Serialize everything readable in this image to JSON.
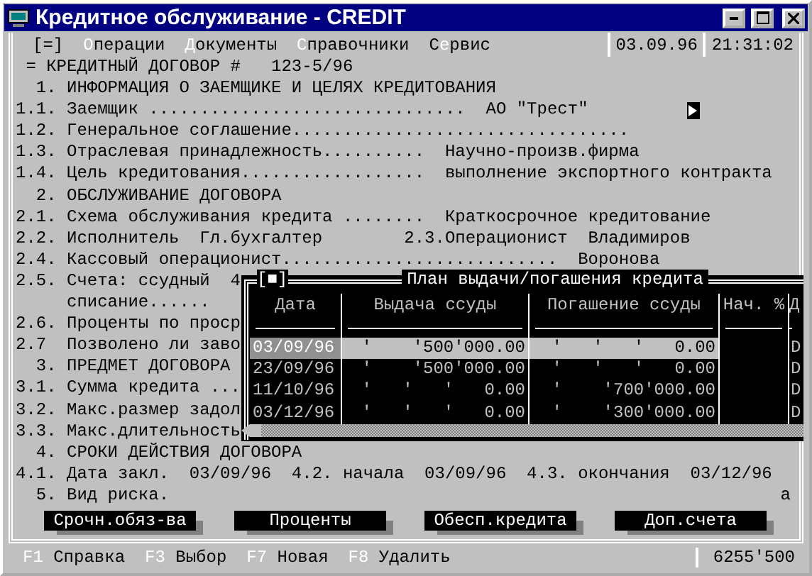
{
  "window": {
    "title": "Кредитное обслуживание - CREDIT"
  },
  "menu": {
    "system": "[=]",
    "items": [
      {
        "hotkey": "О",
        "rest": "перации"
      },
      {
        "hotkey": "Д",
        "rest": "окументы"
      },
      {
        "hotkey": "С",
        "rest": "правочники"
      },
      {
        "hotkey": "е",
        "lead": "С",
        "rest": "рвис"
      }
    ],
    "date": "03.09.96",
    "time": "21:31:02"
  },
  "form": {
    "lines": [
      {
        "text": " = КРЕДИТНЫЙ ДОГОВОР #   123-5/96"
      },
      {
        "text": "  1. ИНФОРМАЦИЯ О ЗАЕМЩИКЕ И ЦЕЛЯХ КРЕДИТОВАНИЯ"
      },
      {
        "text": "1.1. Заемщик ...............................  АО \"Трест\"",
        "marker": true
      },
      {
        "text": "1.2. Генеральное соглашение................................."
      },
      {
        "text": "1.3. Отраслевая принадлежность..........  Научно-произв.фирма"
      },
      {
        "text": "1.4. Цель кредитования..................  выполнение экспортного контракта"
      },
      {
        "text": "  2. ОБСЛУЖИВАНИЕ ДОГОВОРА"
      },
      {
        "text": "2.1. Схема обслуживания кредита ........  Краткосрочное кредитование"
      },
      {
        "text": "2.2. Исполнитель  Гл.бухгалтер        2.3.Операционист  Владимиров"
      },
      {
        "text": "2.4. Кассовый операционист...........................  Воронова"
      },
      {
        "text": "2.5. Счета: ссудный  4"
      },
      {
        "text": "     списание......"
      },
      {
        "text": "2.6. Проценты по проср"
      },
      {
        "text": "2.7  Позволено ли заво"
      },
      {
        "text": "  3. ПРЕДМЕТ ДОГОВОРА"
      },
      {
        "text": "3.1. Сумма кредита ..."
      },
      {
        "text": "3.2. Макс.размер задол"
      },
      {
        "text": "3.3. Макс.длительность"
      },
      {
        "text": "  4. СРОКИ ДЕЙСТВИЯ ДОГОВОРА"
      },
      {
        "text": "4.1. Дата закл.  03/09/96  4.2. начала  03/09/96  4.3. окончания  03/12/96"
      },
      {
        "text": "  5. Вид риска.",
        "right": "a"
      }
    ],
    "buttons": [
      "Срочн.обяз-ва",
      "Проценты",
      "Обесп.кредита",
      "Доп.счета"
    ]
  },
  "popup": {
    "close": "[■]",
    "title": "План выдачи/погашения кредита",
    "columns": [
      "Дата",
      "Выдача ссуды",
      "Погашение ссуды",
      "Нач. %",
      "Д"
    ],
    "rows": [
      {
        "selected": true,
        "date": "03/09/96",
        "issue": "'    '500'000.00",
        "repayment": "'   '   '   0.00",
        "column_5": "D"
      },
      {
        "selected": false,
        "date": "23/09/96",
        "issue": "'    '500'000.00",
        "repayment": "'   '   '   0.00",
        "column_5": "D"
      },
      {
        "selected": false,
        "date": "11/10/96",
        "issue": "'   '   '   0.00",
        "repayment": "'    '700'000.00",
        "column_5": "D"
      },
      {
        "selected": false,
        "date": "03/12/96",
        "issue": "'   '   '   0.00",
        "repayment": "'    '300'000.00",
        "column_5": "D"
      }
    ]
  },
  "status_bar": {
    "keys": [
      {
        "key": "F1",
        "label": "Справка"
      },
      {
        "key": "F3",
        "label": "Выбор"
      },
      {
        "key": "F7",
        "label": "Новая"
      },
      {
        "key": "F8",
        "label": "Удалить"
      }
    ],
    "value": "6255'500"
  }
}
